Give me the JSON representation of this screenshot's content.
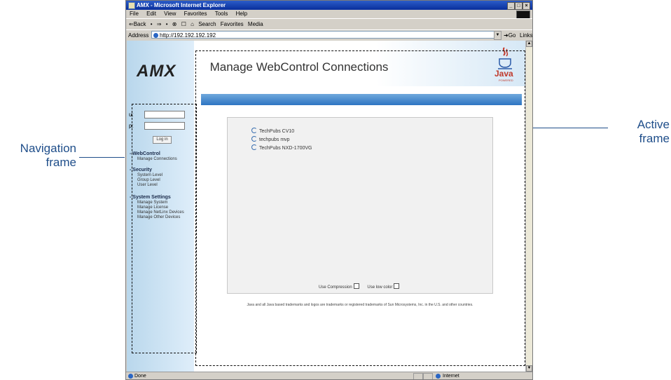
{
  "callouts": {
    "navigation": [
      "Navigation",
      "frame"
    ],
    "active": [
      "Active",
      "frame"
    ]
  },
  "browser": {
    "title": "AMX - Microsoft Internet Explorer",
    "menu": [
      "File",
      "Edit",
      "View",
      "Favorites",
      "Tools",
      "Help"
    ],
    "toolbar": [
      "⇐Back",
      "•",
      "⇒",
      "•",
      "⊗",
      "☐",
      "⌂",
      "Search",
      "Favorites",
      "Media"
    ],
    "address_label": "Address",
    "address_value": "http://192.192.192.192",
    "go_label": "Go",
    "links_label": "Links",
    "status_text": "Done",
    "zone_text": "Internet"
  },
  "nav": {
    "logo": "AMX",
    "user_label": "u:",
    "pass_label": "p:",
    "login_button": "Log in",
    "sections": [
      {
        "heading": "- WebControl",
        "items": [
          "Manage Connections"
        ]
      },
      {
        "heading": "- Security",
        "items": [
          "System Level",
          "Group Level",
          "User Level"
        ]
      },
      {
        "heading": "- System Settings",
        "items": [
          "Manage System",
          "Manage License",
          "Manage NetLinx Devices",
          "Manage Other Devices"
        ]
      }
    ]
  },
  "active": {
    "title": "Manage WebControl Connections",
    "java_logo": "Java",
    "java_sub": "POWERED",
    "connections": [
      "TechPubs CV10",
      "techpubs mvp",
      "TechPubs NXD-1700VG"
    ],
    "option_compression": "Use Compression",
    "option_lowcolor": "Use low color",
    "footer": "Java and all Java based trademarks and logos are trademarks or registered trademarks of Sun Microsystems, Inc. in the U.S. and other countries."
  },
  "colors": {
    "callout": "#1f4e8a",
    "titlebar": "#0a2f9c",
    "nav_bg": "#c9e1f3",
    "header_bar": "#2e74c2"
  }
}
